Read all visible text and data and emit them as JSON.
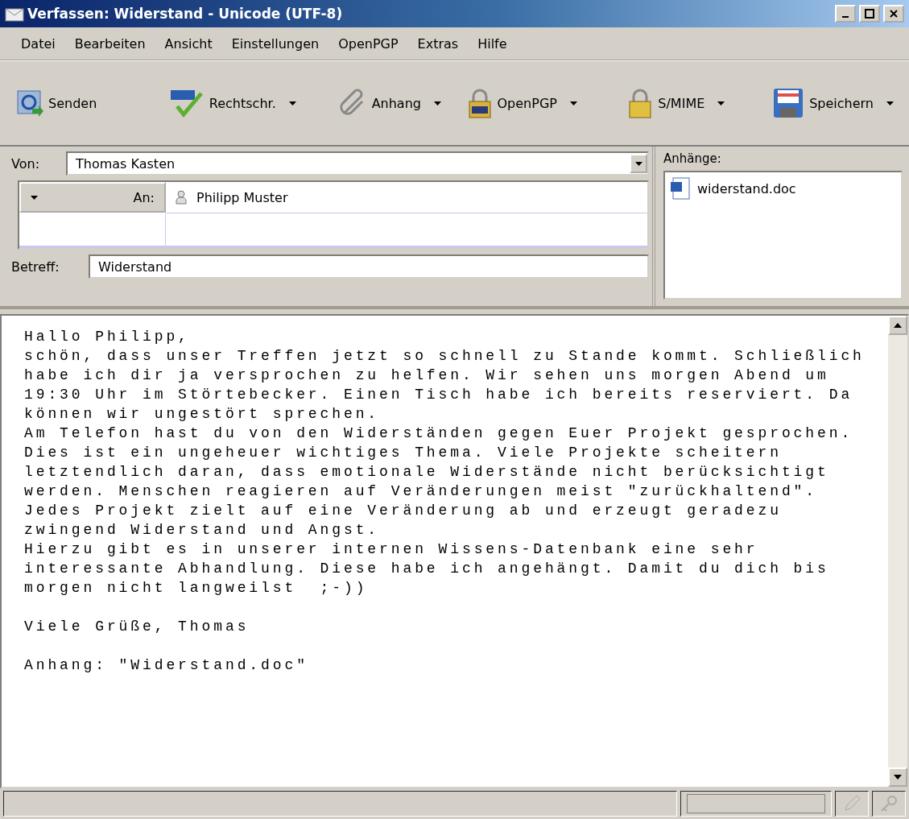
{
  "window": {
    "title": "Verfassen: Widerstand - Unicode (UTF-8)"
  },
  "menu": [
    {
      "label": "Datei"
    },
    {
      "label": "Bearbeiten"
    },
    {
      "label": "Ansicht"
    },
    {
      "label": "Einstellungen"
    },
    {
      "label": "OpenPGP"
    },
    {
      "label": "Extras"
    },
    {
      "label": "Hilfe"
    }
  ],
  "toolbar": [
    {
      "kind": "send",
      "label": "Senden",
      "dropdown": false
    },
    {
      "kind": "spell",
      "label": "Rechtschr.",
      "dropdown": true
    },
    {
      "kind": "attach",
      "label": "Anhang",
      "dropdown": true
    },
    {
      "kind": "pgp",
      "label": "OpenPGP",
      "dropdown": true
    },
    {
      "kind": "smime",
      "label": "S/MIME",
      "dropdown": true
    },
    {
      "kind": "save",
      "label": "Speichern",
      "dropdown": true
    }
  ],
  "from": {
    "label": "Von:",
    "value": "Thomas Kasten"
  },
  "recipients": [
    {
      "type": "An:",
      "address": "Philipp Muster"
    }
  ],
  "subject": {
    "label": "Betreff:",
    "value": "Widerstand"
  },
  "attachments": {
    "label": "Anhänge:",
    "files": [
      "widerstand.doc"
    ]
  },
  "body": [
    [
      "Hallo Philipp,",
      "schön, dass unser Treffen jetzt so schnell zu Stande kommt. Schließlich",
      "habe ich dir ja versprochen zu helfen. Wir sehen uns morgen Abend um",
      "19:30 Uhr im Störtebecker. Einen Tisch habe ich bereits reserviert. Da",
      "können wir ungestört sprechen.",
      "Am Telefon hast du von den Widerständen gegen Euer Projekt gesprochen.",
      "Dies ist ein ungeheuer wichtiges Thema. Viele Projekte scheitern",
      "letztendlich daran, dass emotionale Widerstände nicht berücksichtigt",
      "werden. Menschen reagieren auf Veränderungen meist \"zurückhaltend\".",
      "Jedes Projekt zielt auf eine Veränderung ab und erzeugt geradezu",
      "zwingend Widerstand und Angst.",
      "Hierzu gibt es in unserer internen Wissens-Datenbank eine sehr",
      "interessante Abhandlung. Diese habe ich angehängt. Damit du dich bis",
      "morgen nicht langweilst  ;-))"
    ],
    [
      "Viele Grüße, Thomas"
    ],
    [
      "Anhang: \"Widerstand.doc\""
    ]
  ]
}
